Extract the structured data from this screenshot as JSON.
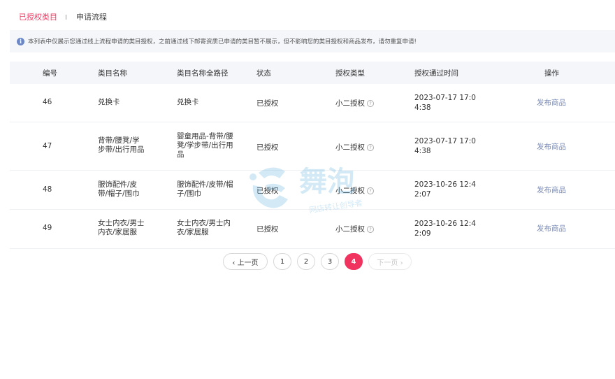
{
  "tabs": {
    "active": "已授权类目",
    "other": "申请流程"
  },
  "notice": {
    "icon": "i",
    "text": "本列表中仅展示您通过线上流程申请的类目授权，之前通过线下邮寄资质已申请的类目暂不展示，但不影响您的类目授权和商品发布，请勿重复申请!"
  },
  "table": {
    "headers": {
      "id": "编号",
      "name": "类目名称",
      "path": "类目名称全路径",
      "status": "状态",
      "type": "授权类型",
      "time": "授权通过时间",
      "op": "操作"
    },
    "rows": [
      {
        "id": "46",
        "name": "兑换卡",
        "path": "兑换卡",
        "status": "已授权",
        "type": "小二授权",
        "time": "2023-07-17 17:04:38",
        "op": "发布商品"
      },
      {
        "id": "47",
        "name": "背带/腰凳/学步带/出行用品",
        "path": "婴童用品-背带/腰凳/学步带/出行用品",
        "status": "已授权",
        "type": "小二授权",
        "time": "2023-07-17 17:04:38",
        "op": "发布商品"
      },
      {
        "id": "48",
        "name": "服饰配件/皮带/帽子/围巾",
        "path": "服饰配件/皮带/帽子/围巾",
        "status": "已授权",
        "type": "小二授权",
        "time": "2023-10-26 12:42:07",
        "op": "发布商品"
      },
      {
        "id": "49",
        "name": "女士内衣/男士内衣/家居服",
        "path": "女士内衣/男士内衣/家居服",
        "status": "已授权",
        "type": "小二授权",
        "time": "2023-10-26 12:42:09",
        "op": "发布商品"
      }
    ]
  },
  "pagination": {
    "prev": "‹ 上一页",
    "pages": [
      "1",
      "2",
      "3",
      "4"
    ],
    "current": "4",
    "next": "下一页 ›"
  },
  "watermark": {
    "title": "舞泡",
    "subtitle": "网店转让创导者"
  },
  "colors": {
    "accent": "#f0345f",
    "link": "#7b8bb5",
    "header_bg": "#f4f6fa"
  }
}
